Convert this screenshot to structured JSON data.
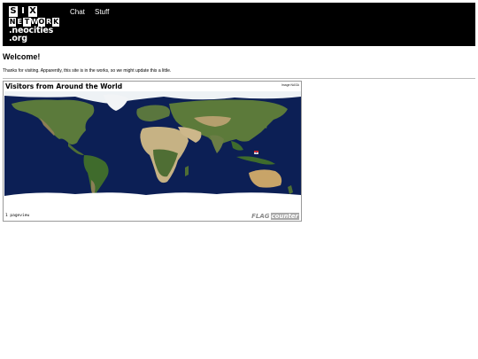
{
  "logo": {
    "row1": [
      "S",
      "I",
      "X"
    ],
    "row2": [
      "N",
      "E",
      "T",
      "W",
      "O",
      "R",
      "K"
    ],
    "line3": ".neocities",
    "line4": ".org"
  },
  "nav": {
    "chat": "Chat",
    "stuff": "Stuff"
  },
  "main": {
    "heading": "Welcome!",
    "intro": "Thanks for visiting. Apparently, this site is in the works, so we might update this a little."
  },
  "flag_counter": {
    "title": "Visitors from Around the World",
    "image_credit": "Image:NASA",
    "pageviews": "1 pageview",
    "brand_flag": "FLAG",
    "brand_counter": "counter"
  },
  "colors": {
    "header_bg": "#000000",
    "ocean": "#0c1f55",
    "land": "#5c7a3a",
    "desert": "#c8b38a",
    "ice": "#ffffff"
  }
}
